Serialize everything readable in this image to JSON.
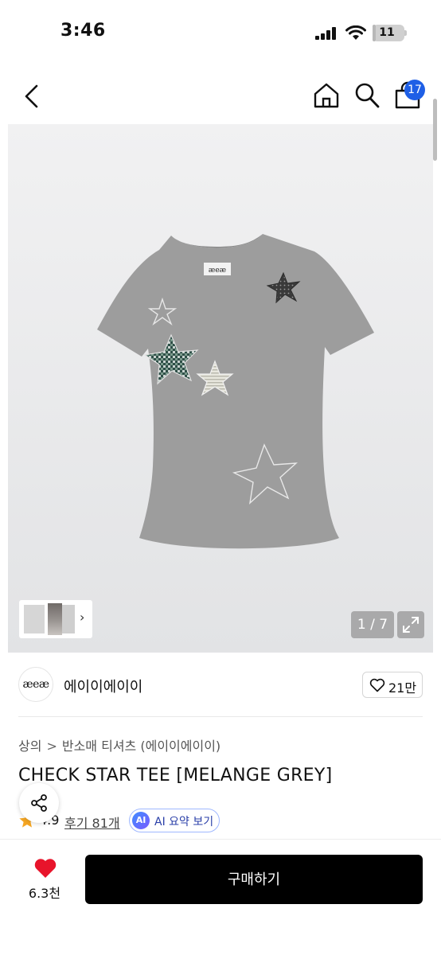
{
  "status_bar": {
    "time": "3:46",
    "battery": "11",
    "battery_level": 0.11
  },
  "nav": {
    "cart_count": "17"
  },
  "gallery": {
    "page_indicator": "1 / 7",
    "thumb_arrow": "›",
    "shirt_label": "æeæ"
  },
  "brand": {
    "logo_text": "æeæ",
    "name": "에이이에이이",
    "like_count": "21만"
  },
  "breadcrumb": {
    "items": [
      "상의",
      "반소매 티셔츠 (에이이에이이)"
    ],
    "separator": ">"
  },
  "product": {
    "title": "CHECK STAR TEE [MELANGE GREY]",
    "rating": "4.9",
    "reviews": "후기 81개",
    "ai_badge": "AI",
    "ai_summary": "AI 요약 보기"
  },
  "bottom_bar": {
    "wishlist_count": "6.3천",
    "buy_label": "구매하기"
  },
  "colors": {
    "cart_badge": "#1e5fe6",
    "wishlist_heart": "#e8142b",
    "rating_star": "#f5a623",
    "buy_button": "#000000",
    "ai_accent": "#4a6cff"
  },
  "icons": {
    "back": "chevron-left-icon",
    "home": "home-icon",
    "search": "search-icon",
    "cart": "shopping-bag-icon",
    "share": "share-icon",
    "like": "heart-outline-icon",
    "wishlist": "heart-filled-icon",
    "fullscreen": "expand-icon",
    "rating": "star-icon"
  }
}
